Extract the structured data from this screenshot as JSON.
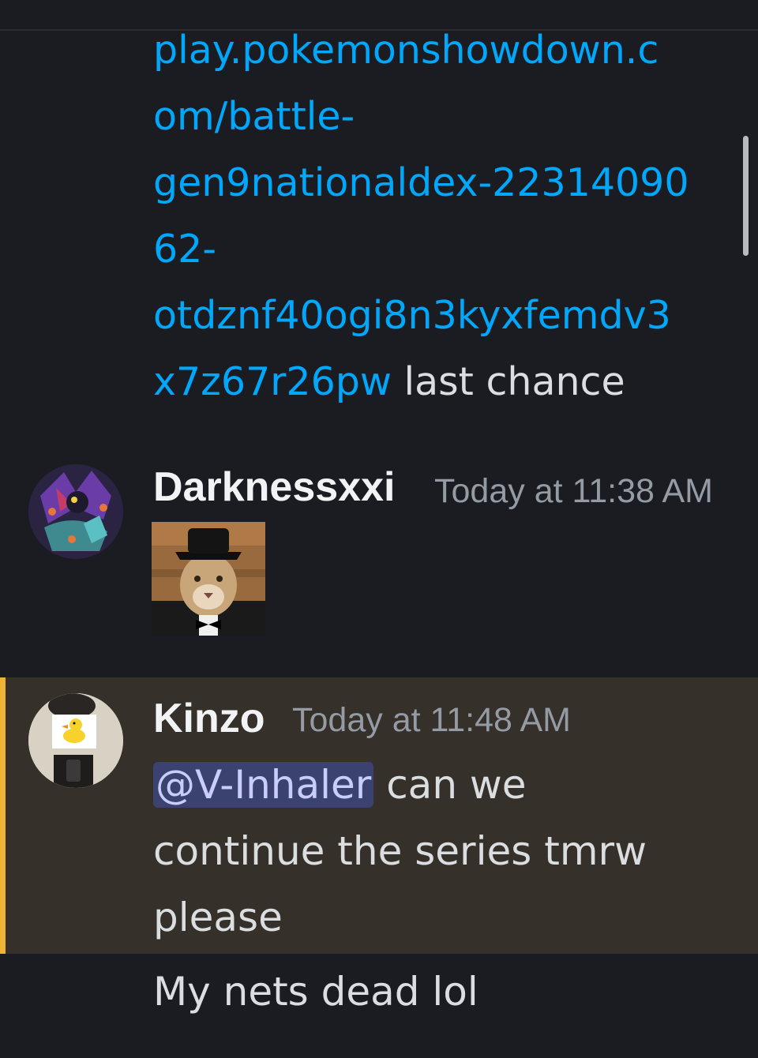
{
  "messages": [
    {
      "link_lines": [
        "play.pokemonshowdown.c",
        "om/battle-",
        "gen9nationaldex-22314090",
        "62-",
        "otdznf40ogi8n3kyxfemdv3",
        "x7z67r26pw"
      ],
      "trailing_text": " last chance"
    },
    {
      "author": "Darknessxxi",
      "timestamp": "Today at 11:38 AM",
      "attachment": "image"
    },
    {
      "author": "Kinzo",
      "timestamp": "Today at 11:48 AM",
      "mention": "@V-Inhaler",
      "text_line_1": " can we",
      "text_line_2": "continue the series tmrw",
      "text_line_3": "please",
      "highlighted": true
    },
    {
      "text": "My nets dead lol"
    }
  ],
  "colors": {
    "background": "#1b1c22",
    "link": "#00a8fc",
    "mention_bg": "#3c4270",
    "mention_text": "#c9cdfb",
    "highlight_bg": "#353029",
    "highlight_bar": "#f0b232"
  }
}
